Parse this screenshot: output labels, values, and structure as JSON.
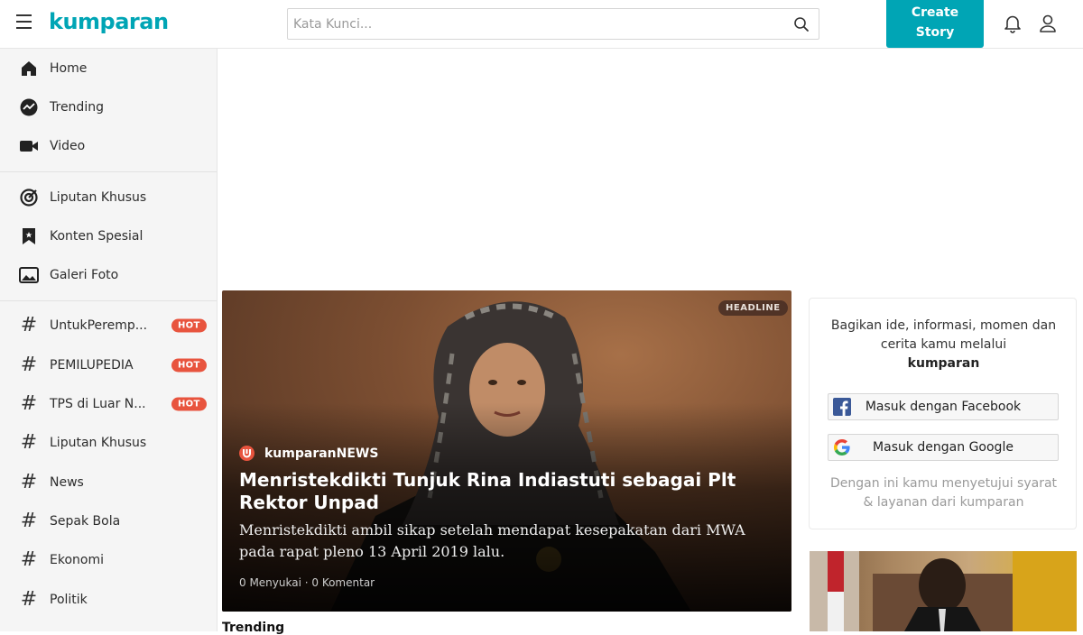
{
  "header": {
    "logo": "kumparan",
    "search_placeholder": "Kata Kunci...",
    "create_story_line1": "Create",
    "create_story_line2": "Story"
  },
  "sidebar": {
    "main": [
      {
        "label": "Home",
        "icon": "home-icon"
      },
      {
        "label": "Trending",
        "icon": "trending-icon"
      },
      {
        "label": "Video",
        "icon": "video-icon"
      }
    ],
    "special": [
      {
        "label": "Liputan Khusus",
        "icon": "target-icon"
      },
      {
        "label": "Konten Spesial",
        "icon": "bookmark-icon"
      },
      {
        "label": "Galeri Foto",
        "icon": "image-icon"
      }
    ],
    "topics": [
      {
        "label": "UntukPeremp...",
        "hot": "HOT"
      },
      {
        "label": "PEMILUPEDIA",
        "hot": "HOT"
      },
      {
        "label": "TPS di Luar N...",
        "hot": "HOT"
      },
      {
        "label": "Liputan Khusus"
      },
      {
        "label": "News"
      },
      {
        "label": "Sepak Bola"
      },
      {
        "label": "Ekonomi"
      },
      {
        "label": "Politik"
      }
    ],
    "hash_symbol": "#"
  },
  "headline": {
    "badge": "HEADLINE",
    "publisher": "kumparanNEWS",
    "title": "Menristekdikti Tunjuk Rina Indiastuti sebagai Plt Rektor Unpad",
    "description": "Menristekdikti ambil sikap setelah mendapat kesepakatan dari MWA pada rapat pleno 13 April 2019 lalu.",
    "meta": "0 Menyukai · 0 Komentar"
  },
  "section": {
    "trending_label": "Trending"
  },
  "login_card": {
    "intro": "Bagikan ide, informasi, momen dan cerita kamu melalui",
    "brand": "kumparan",
    "facebook_label": "Masuk dengan Facebook",
    "google_label": "Masuk dengan Google",
    "terms": "Dengan ini kamu menyetujui syarat & layanan dari kumparan"
  },
  "colors": {
    "brand": "#00a5b5",
    "hot": "#e8543e",
    "facebook": "#3b5998"
  }
}
